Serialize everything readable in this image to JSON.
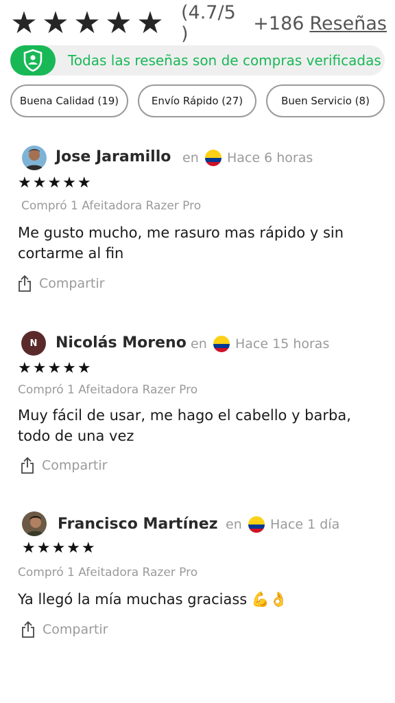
{
  "header": {
    "stars": [
      "★",
      "★",
      "★",
      "★",
      "★"
    ],
    "rating_text": "(4.7/5 )",
    "count_text": "+186",
    "reviews_link": "Reseñas"
  },
  "verified": {
    "text": "Todas las reseñas son de compras verificadas",
    "icon": "shield-user-icon",
    "color": "#18b856"
  },
  "filters": [
    {
      "label": "Buena Calidad (19)"
    },
    {
      "label": "Envío Rápido (27)"
    },
    {
      "label": "Buen Servicio (8)"
    }
  ],
  "reviews": [
    {
      "name": "Jose Jaramillo",
      "en": "en",
      "time": "Hace 6 horas",
      "stars": "★★★★★",
      "purchase": "Compró 1 Afeitadora Razer Pro",
      "text": "Me gusto mucho, me rasuro mas rápido y sin cortarme al fin",
      "share": "Compartir"
    },
    {
      "name": "Nicolás Moreno",
      "avatar_letter": "N",
      "en": "en",
      "time": "Hace 15 horas",
      "stars": "★★★★★",
      "purchase": "Compró 1 Afeitadora Razer Pro",
      "text": "Muy fácil de usar, me hago el cabello y barba, todo de una vez",
      "share": "Compartir"
    },
    {
      "name": "Francisco Martínez",
      "en": "en",
      "time": "Hace 1 día",
      "stars": "★★★★★",
      "purchase": "Compró 1 Afeitadora Razer Pro",
      "text": "Ya llegó la mía muchas graciass 💪👌",
      "share": "Compartir"
    }
  ],
  "colors": {
    "accent": "#18b856",
    "muted": "#9a9a9a",
    "flag_yellow": "#fcd116",
    "flag_blue": "#003893",
    "flag_red": "#ce1126"
  }
}
